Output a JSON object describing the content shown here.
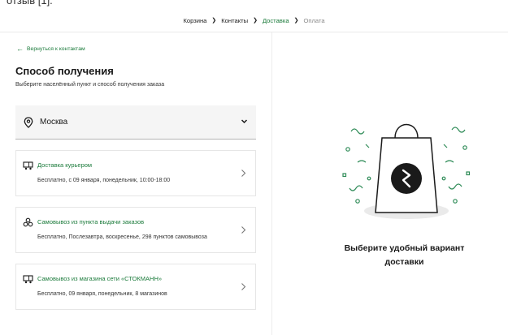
{
  "top_strip_text": "отзыв [1].",
  "breadcrumb": {
    "items": [
      "Корзина",
      "Контакты",
      "Доставка",
      "Оплата"
    ]
  },
  "back_link": "Вернуться к контактам",
  "page_title": "Способ получения",
  "page_subtitle": "Выберите населённый пункт и способ получения заказа",
  "city_select": {
    "value": "Москва",
    "icon": "map-pin-icon"
  },
  "delivery_options": [
    {
      "icon": "delivery-truck-icon",
      "label": "Доставка курьером",
      "description": "Бесплатно, с 09 января, понедельник, 10:00-18:00"
    },
    {
      "icon": "pickup-point-icon",
      "label": "Самовывоз из пункта выдачи заказов",
      "description": "Бесплатно, Послезавтра, воскресенье, 298 пунктов самовывоза"
    },
    {
      "icon": "delivery-truck-icon",
      "label": "Самовывоз из магазина сети «СТОКМАНН»",
      "description": "Бесплатно, 09 января, понедельник, 8 магазинов"
    }
  ],
  "promo": {
    "text": "Выберите удобный вариант доставки",
    "accent_color": "#1a7a3a",
    "confetti_color": "#2e8b57"
  }
}
